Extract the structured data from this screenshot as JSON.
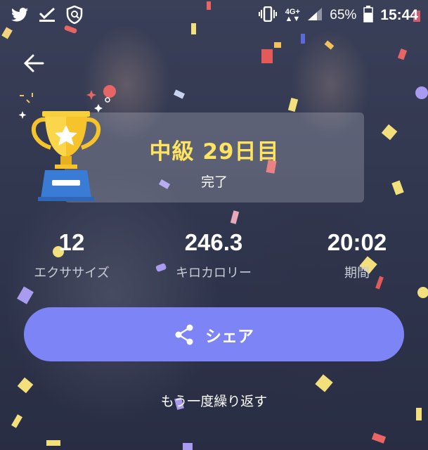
{
  "status_bar": {
    "network_top": "4G+",
    "network_bottom": "▲▼",
    "battery": "65%",
    "time": "15:44"
  },
  "icons": {
    "back": "arrow-left-icon",
    "share": "share-icon",
    "trophy": "trophy-icon"
  },
  "achievement": {
    "title": "中級 29日目",
    "subtitle": "完了"
  },
  "stats": [
    {
      "value": "12",
      "label": "エクササイズ"
    },
    {
      "value": "246.3",
      "label": "キロカロリー"
    },
    {
      "value": "20:02",
      "label": "期間"
    }
  ],
  "share_button": {
    "label": "シェア"
  },
  "repeat_link": {
    "label": "もう一度繰り返す"
  },
  "colors": {
    "accent": "#7c84f6",
    "title": "#ffe460",
    "trophy_gold": "#f6c42a",
    "trophy_base": "#3a7bd5"
  }
}
